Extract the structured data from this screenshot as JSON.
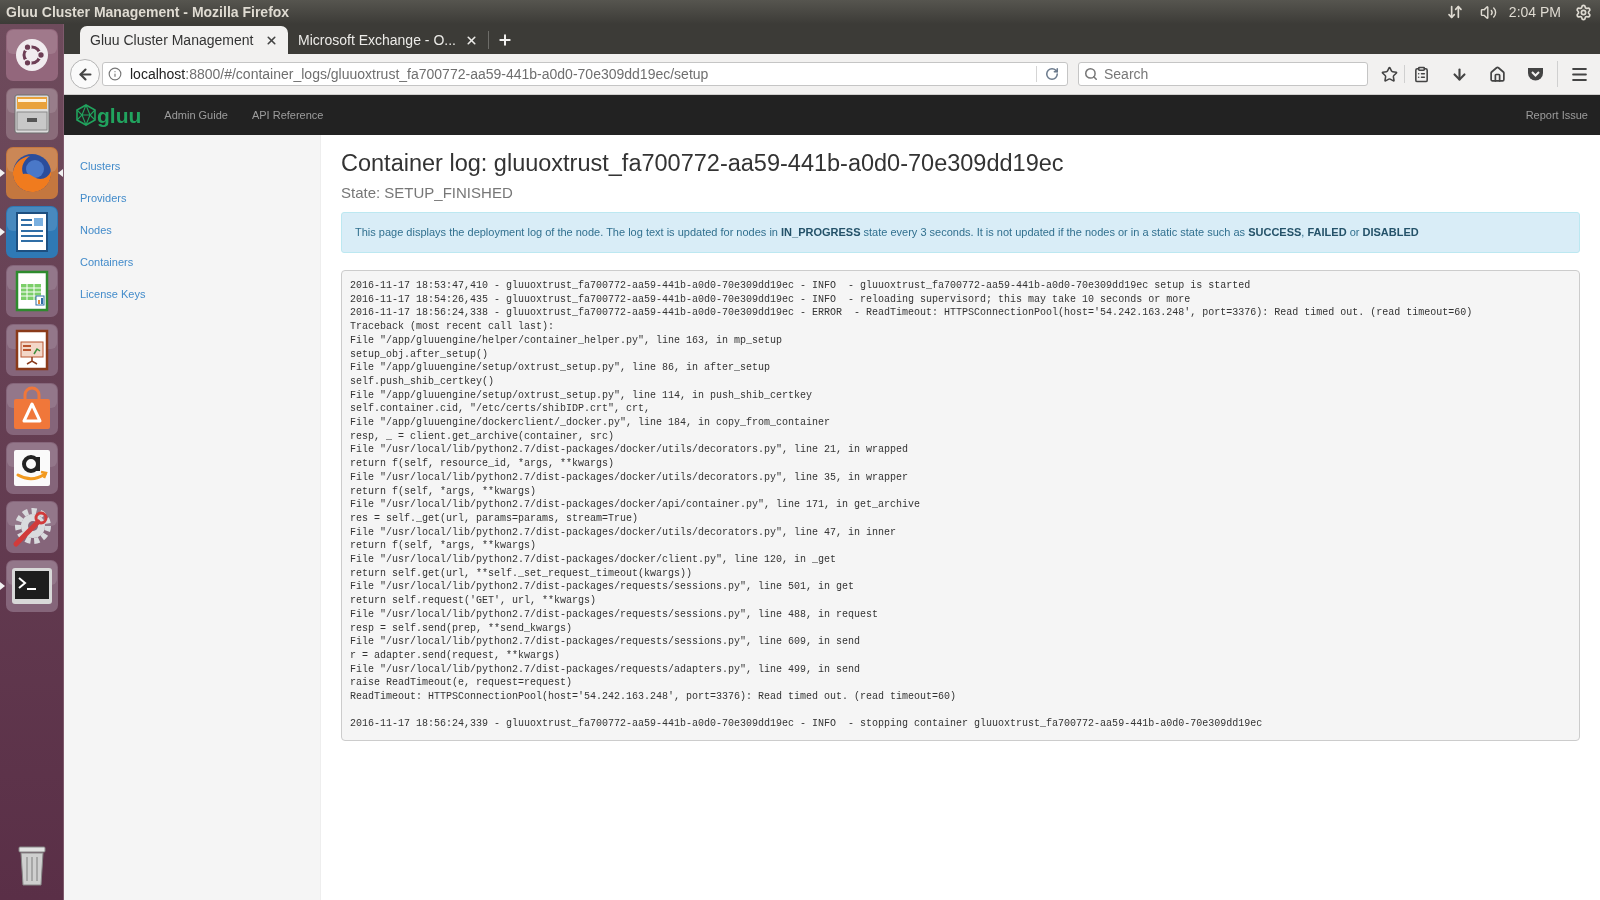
{
  "desktop_panel": {
    "window_title": "Gluu Cluster Management - Mozilla Firefox",
    "clock": "2:04 PM"
  },
  "launcher": {
    "items": [
      {
        "running": false,
        "focused": false
      },
      {
        "running": false,
        "focused": false
      },
      {
        "running": true,
        "focused": true
      },
      {
        "running": true,
        "focused": false
      },
      {
        "running": false,
        "focused": false
      },
      {
        "running": false,
        "focused": false
      },
      {
        "running": false,
        "focused": false
      },
      {
        "running": false,
        "focused": false
      },
      {
        "running": false,
        "focused": false
      },
      {
        "running": true,
        "focused": false
      }
    ]
  },
  "browser": {
    "tabs": [
      {
        "title": "Gluu Cluster Management",
        "selected": true
      },
      {
        "title": "Microsoft Exchange - O...",
        "selected": false
      }
    ],
    "url": {
      "host": "localhost",
      "rest": ":8800/#/container_logs/gluuoxtrust_fa700772-aa59-441b-a0d0-70e309dd19ec/setup"
    },
    "search": {
      "placeholder": "Search"
    }
  },
  "app_navbar": {
    "brand": "gluu",
    "links": [
      "Admin Guide",
      "API Reference"
    ],
    "right_link": "Report Issue"
  },
  "sidebar": {
    "items": [
      "Clusters",
      "Providers",
      "Nodes",
      "Containers",
      "License Keys"
    ]
  },
  "page": {
    "title": "Container log: gluuoxtrust_fa700772-aa59-441b-a0d0-70e309dd19ec",
    "state": "State: SETUP_FINISHED",
    "alert": "This page displays the deployment log of the node. The log text is updated for nodes in **IN_PROGRESS** state every 3 seconds. It is not updated if the nodes or in a static state such as **SUCCESS**, **FAILED** or **DISABLED**",
    "log": {
      "blocks": [
        [
          "2016-11-17 18:53:47,410 - gluuoxtrust_fa700772-aa59-441b-a0d0-70e309dd19ec - INFO  - gluuoxtrust_fa700772-aa59-441b-a0d0-70e309dd19ec setup is started",
          "2016-11-17 18:54:26,435 - gluuoxtrust_fa700772-aa59-441b-a0d0-70e309dd19ec - INFO  - reloading supervisord; this may take 10 seconds or more",
          "2016-11-17 18:56:24,338 - gluuoxtrust_fa700772-aa59-441b-a0d0-70e309dd19ec - ERROR  - ReadTimeout: HTTPSConnectionPool(host='54.242.163.248', port=3376): Read timed out. (read timeout=60)",
          "Traceback (most recent call last):",
          "File \"/app/gluuengine/helper/container_helper.py\", line 163, in mp_setup",
          "setup_obj.after_setup()",
          "File \"/app/gluuengine/setup/oxtrust_setup.py\", line 86, in after_setup",
          "self.push_shib_certkey()",
          "File \"/app/gluuengine/setup/oxtrust_setup.py\", line 114, in push_shib_certkey",
          "self.container.cid, \"/etc/certs/shibIDP.crt\", crt,",
          "File \"/app/gluuengine/dockerclient/_docker.py\", line 184, in copy_from_container",
          "resp, _ = client.get_archive(container, src)",
          "File \"/usr/local/lib/python2.7/dist-packages/docker/utils/decorators.py\", line 21, in wrapped",
          "return f(self, resource_id, *args, **kwargs)",
          "File \"/usr/local/lib/python2.7/dist-packages/docker/utils/decorators.py\", line 35, in wrapper",
          "return f(self, *args, **kwargs)",
          "File \"/usr/local/lib/python2.7/dist-packages/docker/api/container.py\", line 171, in get_archive",
          "res = self._get(url, params=params, stream=True)",
          "File \"/usr/local/lib/python2.7/dist-packages/docker/utils/decorators.py\", line 47, in inner",
          "return f(self, *args, **kwargs)",
          "File \"/usr/local/lib/python2.7/dist-packages/docker/client.py\", line 120, in _get",
          "return self.get(url, **self._set_request_timeout(kwargs))",
          "File \"/usr/local/lib/python2.7/dist-packages/requests/sessions.py\", line 501, in get",
          "return self.request('GET', url, **kwargs)",
          "File \"/usr/local/lib/python2.7/dist-packages/requests/sessions.py\", line 488, in request",
          "resp = self.send(prep, **send_kwargs)",
          "File \"/usr/local/lib/python2.7/dist-packages/requests/sessions.py\", line 609, in send",
          "r = adapter.send(request, **kwargs)",
          "File \"/usr/local/lib/python2.7/dist-packages/requests/adapters.py\", line 499, in send",
          "raise ReadTimeout(e, request=request)",
          "ReadTimeout: HTTPSConnectionPool(host='54.242.163.248', port=3376): Read timed out. (read timeout=60)"
        ],
        [
          "2016-11-17 18:56:24,339 - gluuoxtrust_fa700772-aa59-441b-a0d0-70e309dd19ec - INFO  - stopping container gluuoxtrust_fa700772-aa59-441b-a0d0-70e309dd19ec"
        ]
      ]
    }
  }
}
